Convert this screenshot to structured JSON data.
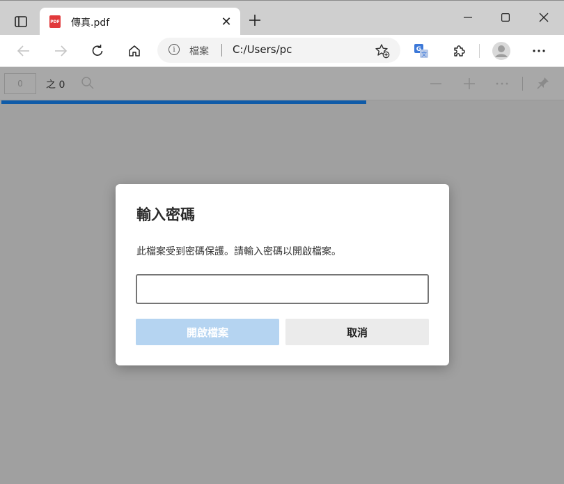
{
  "tab": {
    "title": "傳真.pdf",
    "icon": "pdf-file-icon",
    "icon_text": "PDF"
  },
  "window": {
    "minimize": "minimize-icon",
    "maximize": "maximize-icon",
    "close": "close-icon"
  },
  "address_bar": {
    "site_label": "檔案",
    "url": "C:/Users/pc"
  },
  "pdf_toolbar": {
    "page_value": "0",
    "page_total": "之 0",
    "progress": 0.65
  },
  "dialog": {
    "title": "輸入密碼",
    "message": "此檔案受到密碼保護。請輸入密碼以開啟檔案。",
    "password_value": "",
    "open_label": "開啟檔案",
    "cancel_label": "取消"
  },
  "colors": {
    "accent": "#0f5ba8",
    "disabled_button": "#b5d4f1",
    "overlay": "#a0a0a0"
  }
}
